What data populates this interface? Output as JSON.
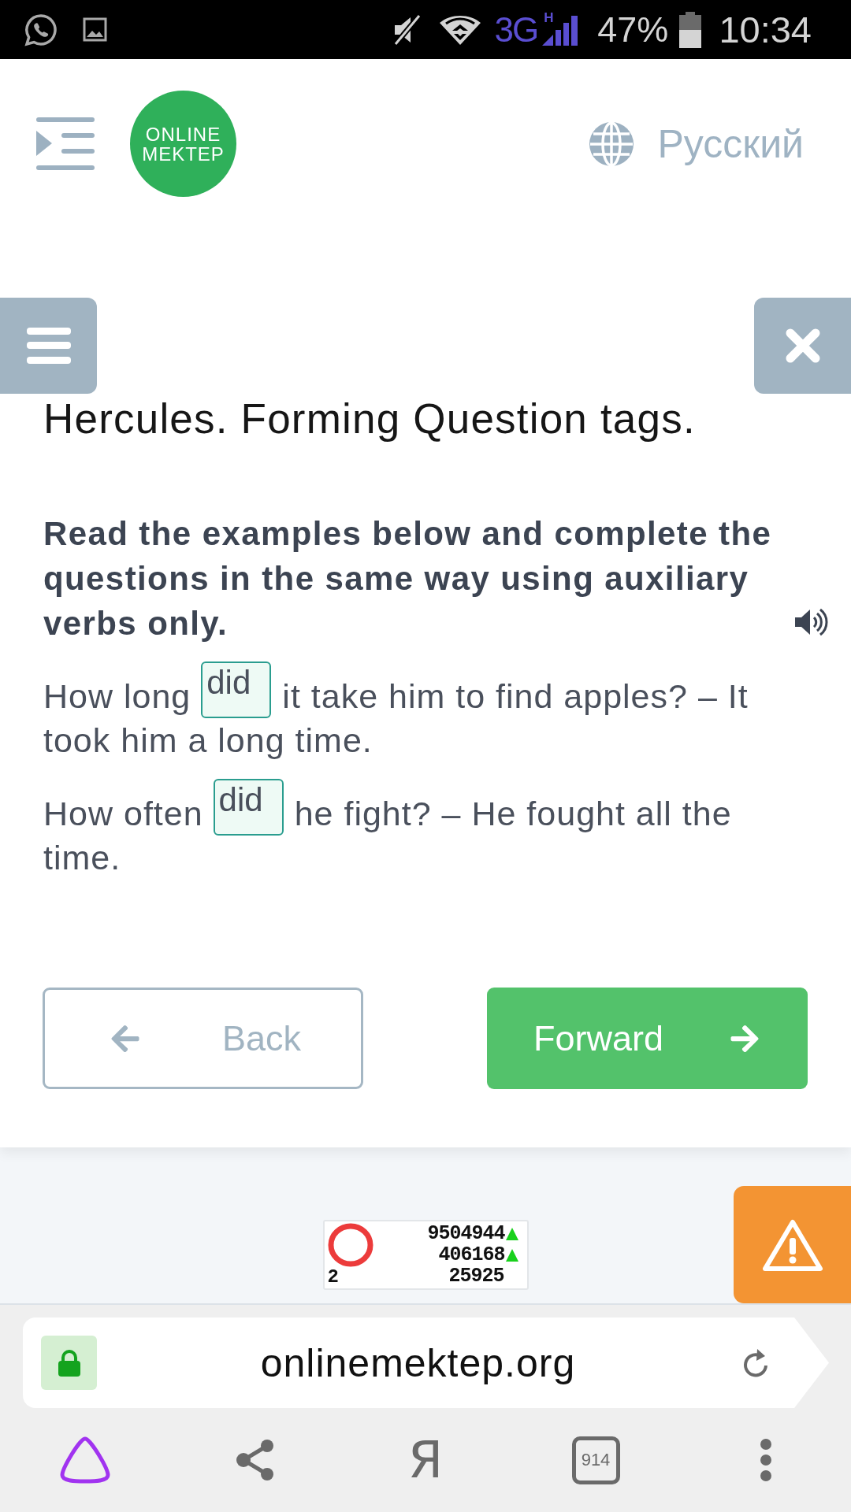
{
  "status_bar": {
    "network": "3G",
    "network_sub": "H",
    "battery": "47%",
    "time": "10:34"
  },
  "header": {
    "logo_lines": [
      "ONLINE",
      "MEKTEP"
    ],
    "language": "Русский"
  },
  "lesson": {
    "title": "Hercules. Forming Question tags.",
    "instruction": "Read the examples below and complete the questions in the same way using auxiliary verbs only.",
    "sentences": [
      {
        "parts": [
          {
            "kind": "text",
            "text": "How long"
          },
          {
            "kind": "blank",
            "value": "did"
          },
          {
            "kind": "text",
            "text": "it take him to find apples? – It took him a long time."
          }
        ]
      },
      {
        "parts": [
          {
            "kind": "text",
            "text": "How often"
          },
          {
            "kind": "blank",
            "value": "did"
          },
          {
            "kind": "text",
            "text": "he fight? – He fought all the time."
          }
        ]
      }
    ]
  },
  "navigation": [
    {
      "kind": "back",
      "label": "Back"
    },
    {
      "kind": "forward",
      "label": "Forward"
    }
  ],
  "counter": {
    "rank": "2",
    "rows": [
      {
        "value": "9504944",
        "rising": true
      },
      {
        "value": "406168",
        "rising": true
      },
      {
        "value": "25925",
        "rising": false
      }
    ]
  },
  "browser": {
    "url": "onlinemektep.org",
    "secure": true,
    "toolbar_letter": "Я",
    "tab_count": "914"
  }
}
